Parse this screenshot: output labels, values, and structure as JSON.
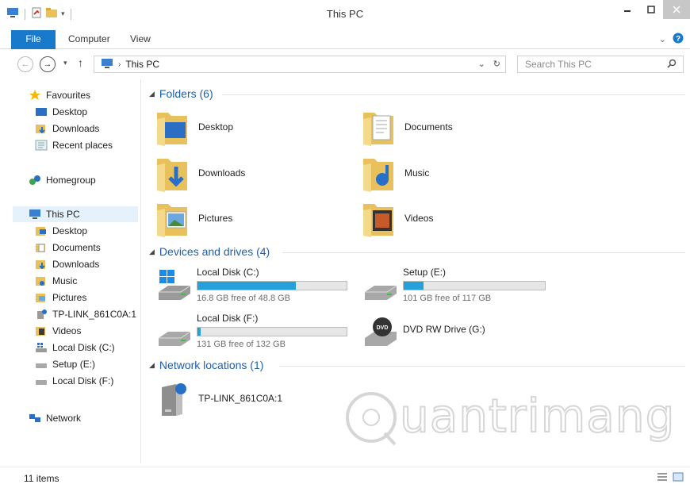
{
  "window": {
    "title": "This PC"
  },
  "ribbon": {
    "tabs": [
      "File",
      "Computer",
      "View"
    ]
  },
  "address": {
    "location": "This PC",
    "search_placeholder": "Search This PC"
  },
  "nav": {
    "favourites": {
      "label": "Favourites",
      "items": [
        "Desktop",
        "Downloads",
        "Recent places"
      ]
    },
    "homegroup": "Homegroup",
    "thispc": {
      "label": "This PC",
      "items": [
        "Desktop",
        "Documents",
        "Downloads",
        "Music",
        "Pictures",
        "TP-LINK_861C0A:1",
        "Videos",
        "Local Disk (C:)",
        "Setup (E:)",
        "Local Disk (F:)"
      ]
    },
    "network": "Network"
  },
  "groups": {
    "folders": {
      "header": "Folders (6)",
      "items": [
        "Desktop",
        "Documents",
        "Downloads",
        "Music",
        "Pictures",
        "Videos"
      ]
    },
    "devices": {
      "header": "Devices and drives (4)",
      "items": [
        {
          "name": "Local Disk (C:)",
          "free_text": "16.8 GB free of 48.8 GB",
          "used_fraction": 0.66
        },
        {
          "name": "Setup (E:)",
          "free_text": "101 GB free of 117 GB",
          "used_fraction": 0.14
        },
        {
          "name": "Local Disk (F:)",
          "free_text": "131 GB free of 132 GB",
          "used_fraction": 0.01
        },
        {
          "name": "DVD RW Drive (G:)"
        }
      ]
    },
    "network": {
      "header": "Network locations (1)",
      "items": [
        "TP-LINK_861C0A:1"
      ]
    }
  },
  "status": {
    "items_count": "11 items"
  },
  "watermark": {
    "text": "uantrimang"
  },
  "colors": {
    "accent": "#1979ca",
    "drive_bar": "#26a0da",
    "group_header": "#1e5fa8"
  }
}
